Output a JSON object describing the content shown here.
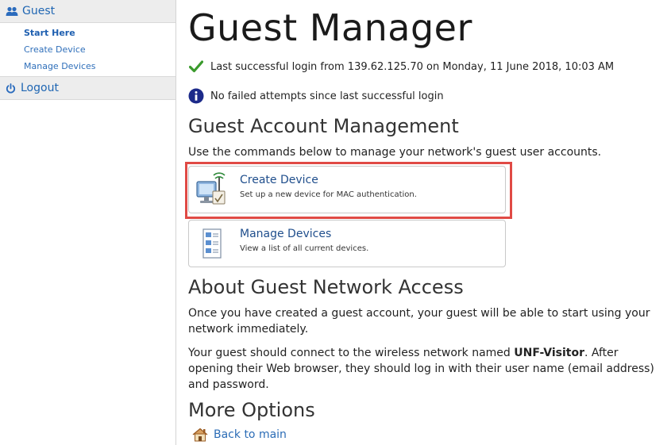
{
  "sidebar": {
    "header_label": "Guest",
    "items": [
      {
        "label": "Start Here",
        "active": true
      },
      {
        "label": "Create Device",
        "active": false
      },
      {
        "label": "Manage Devices",
        "active": false
      }
    ],
    "logout_label": "Logout"
  },
  "main": {
    "title": "Guest Manager",
    "login_status": "Last successful login from 139.62.125.70 on Monday, 11 June 2018, 10:03 AM",
    "failed_status": "No failed attempts since last successful login",
    "account_heading": "Guest Account Management",
    "account_intro": "Use the commands below to manage your network's guest user accounts.",
    "commands": [
      {
        "title": "Create Device",
        "description": "Set up a new device for MAC authentication."
      },
      {
        "title": "Manage Devices",
        "description": "View a list of all current devices."
      }
    ],
    "about_heading": "About Guest Network Access",
    "about_p1": "Once you have created a guest account, your guest will be able to start using your network immediately.",
    "about_p2_before": "Your guest should connect to the wireless network named ",
    "about_p2_network": "UNF-Visitor",
    "about_p2_after": ". After opening their Web browser, they should log in with their user name (email address) and password.",
    "more_heading": "More Options",
    "back_label": "Back to main"
  },
  "colors": {
    "accent_link": "#2b6cb6",
    "highlight": "#e04a45",
    "success_check": "#3a9a2c",
    "info_icon": "#1c2a8a"
  }
}
